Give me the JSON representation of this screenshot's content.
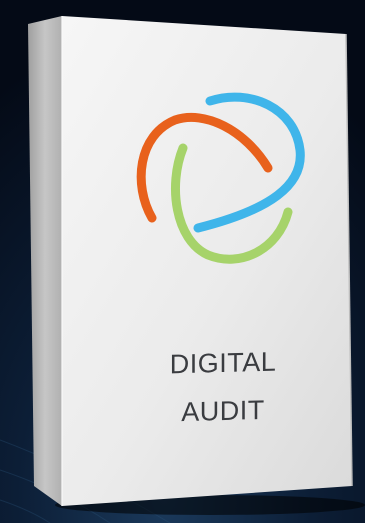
{
  "product": {
    "title_line1": "DIGITAL",
    "title_line2": "AUDIT",
    "logo": {
      "icon_name": "tri-swirl-logo-icon",
      "colors": {
        "orange": "#e8611c",
        "blue": "#3fb5ea",
        "green": "#a6d36a"
      }
    }
  },
  "colors": {
    "background_dark": "#050d1c",
    "background_glow": "#16324f",
    "box_front": "#ececec",
    "box_side": "#b9b9b9",
    "box_top": "#d8d8d8",
    "text": "#3a3c40"
  }
}
